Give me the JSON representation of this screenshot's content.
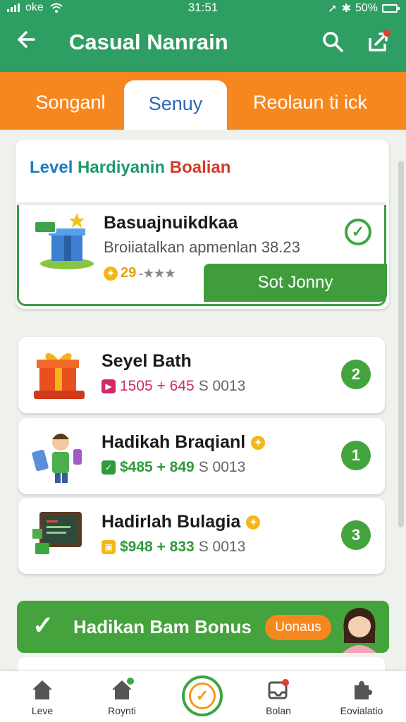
{
  "status_bar": {
    "carrier": "oke",
    "time": "31:51",
    "battery": "50%"
  },
  "app_bar": {
    "title": "Casual Nanrain",
    "back_icon": "arrow-left-icon",
    "search_icon": "search-icon",
    "share_icon": "share-icon"
  },
  "tabs": [
    {
      "label": "Songanl",
      "active": false
    },
    {
      "label": "Senuy",
      "active": true
    },
    {
      "label": "Reolaun ti ick",
      "active": false
    }
  ],
  "featured": {
    "heading_parts": [
      "Level ",
      "Hardiyanin ",
      "Boalian"
    ],
    "title": "Basuajnuikdkaa",
    "subtitle": "Broiiatalkan apmenlan 38.23",
    "points": "29",
    "rating_text": "-★★★",
    "button": "Sot Jonny"
  },
  "items": [
    {
      "title": "Seyel Bath",
      "value": "1505 + 645",
      "extra": "S 0013",
      "badge": "2"
    },
    {
      "title": "Hadikah Braqianl",
      "value": "$485 + 849",
      "extra": "S 0013",
      "badge": "1"
    },
    {
      "title": "Hadirlah Bulagia",
      "value": "$948 + 833",
      "extra": "S 0013",
      "badge": "3"
    }
  ],
  "bonus": {
    "title": "Hadikan Bam Bonus",
    "pill": "Uonaus"
  },
  "bottom_nav": [
    {
      "label": "Leve",
      "icon": "home-icon"
    },
    {
      "label": "Roynti",
      "icon": "home-badge-icon"
    },
    {
      "label": "",
      "icon": "center-action-icon"
    },
    {
      "label": "Bolan",
      "icon": "inbox-icon"
    },
    {
      "label": "Eovialatio",
      "icon": "puzzle-icon"
    }
  ],
  "colors": {
    "primary": "#2e9e63",
    "accent": "#f6871f",
    "button_green": "#3f9d3b"
  }
}
